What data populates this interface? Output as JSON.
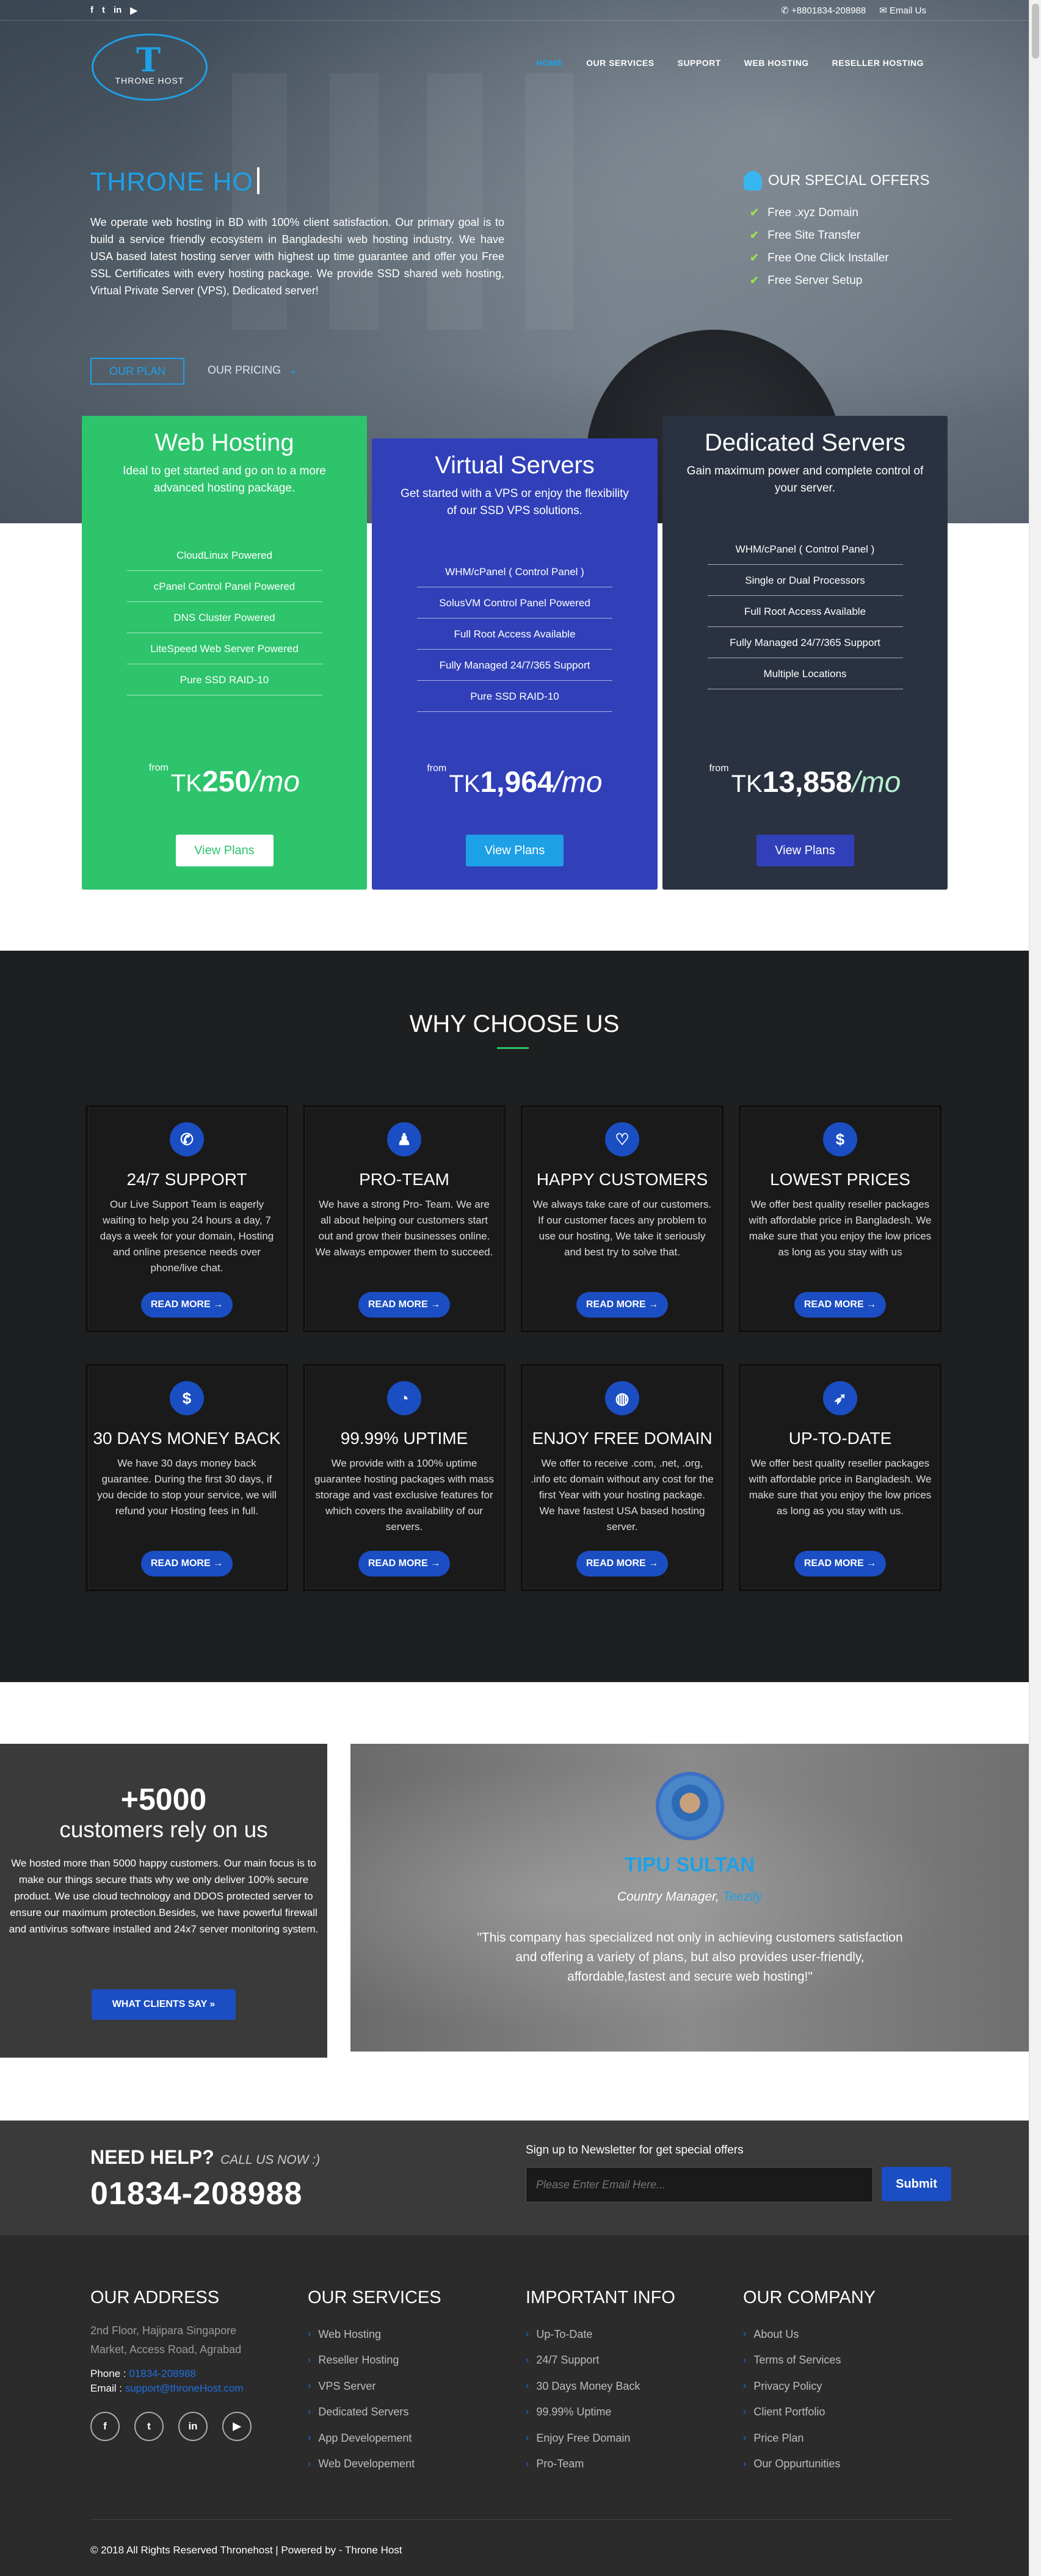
{
  "topbar": {
    "social": [
      "f",
      "t",
      "in",
      "▶"
    ],
    "phone": "+8801834-208988",
    "email": "Email Us"
  },
  "logo": {
    "text": "THRONE HOST"
  },
  "nav": [
    "HOME",
    "OUR SERVICES",
    "SUPPORT",
    "WEB HOSTING",
    "RESELLER HOSTING"
  ],
  "hero": {
    "title": "THRONE HO",
    "description": "We operate web hosting in BD with 100% client satisfaction. Our primary goal is to build a service friendly ecosystem in Bangladeshi web hosting industry. We have USA based latest hosting server with highest up time guarantee and offer you Free SSL Certificates with every hosting package. We provide SSD shared web hosting, Virtual Private Server (VPS), Dedicated server!",
    "plan_button": "OUR PLAN",
    "pricing_button": "OUR PRICING"
  },
  "offers": {
    "title": "OUR SPECIAL OFFERS",
    "items": [
      "Free .xyz Domain",
      "Free Site Transfer",
      "Free One Click Installer",
      "Free Server Setup"
    ]
  },
  "pricing": [
    {
      "title": "Web Hosting",
      "subtitle": "Ideal to get started and go on to a more advanced hosting package.",
      "features": [
        "CloudLinux Powered",
        "cPanel Control Panel Powered",
        "DNS Cluster Powered",
        "LiteSpeed Web Server Powered",
        "Pure SSD RAID-10"
      ],
      "from": "from",
      "currency": "TK",
      "amount": "250",
      "period": "/mo",
      "button": "View Plans",
      "color": "#2dc46c"
    },
    {
      "title": "Virtual Servers",
      "subtitle": "Get started with a VPS or enjoy the flexibility of our SSD VPS solutions.",
      "features": [
        "WHM/cPanel ( Control Panel )",
        "SolusVM Control Panel Powered",
        "Full Root Access Available",
        "Fully Managed 24/7/365 Support",
        "Pure SSD RAID-10"
      ],
      "from": "from",
      "currency": "TK",
      "amount": "1,964",
      "period": "/mo",
      "button": "View Plans",
      "color": "#3140b8"
    },
    {
      "title": "Dedicated Servers",
      "subtitle": "Gain maximum power and complete control of your server.",
      "features": [
        "WHM/cPanel ( Control Panel )",
        "Single or Dual Processors",
        "Full Root Access Available",
        "Fully Managed 24/7/365 Support",
        "Multiple Locations"
      ],
      "from": "from",
      "currency": "TK",
      "amount": "13,858",
      "period": "/mo",
      "button": "View Plans",
      "color": "#2a3140"
    }
  ],
  "why": {
    "title": "WHY CHOOSE US",
    "read_more": "READ MORE →",
    "features": [
      {
        "icon": "phone-icon",
        "glyph": "✆",
        "title": "24/7 SUPPORT",
        "text": "Our Live Support Team is eagerly waiting to help you 24 hours a day, 7 days a week for your domain, Hosting and online presence needs over phone/live chat."
      },
      {
        "icon": "team-icon",
        "glyph": "♟",
        "title": "PRO-TEAM",
        "text": "We have a strong Pro- Team. We are all about helping our customers start out and grow their businesses online. We always empower them to succeed."
      },
      {
        "icon": "heart-icon",
        "glyph": "♡",
        "title": "HAPPY CUSTOMERS",
        "text": "We always take care of our customers. If our customer faces any problem to use our hosting, We take it seriously and best try to solve that."
      },
      {
        "icon": "money-icon",
        "glyph": "$",
        "title": "LOWEST PRICES",
        "text": "We offer best quality reseller packages with affordable price in Bangladesh. We make sure that you enjoy the low prices as long as you stay with us"
      },
      {
        "icon": "money-back-icon",
        "glyph": "$",
        "title": "30 DAYS MONEY BACK",
        "text": "We have 30 days money back guarantee. During the first 30 days, if you decide to stop your service, we will refund your Hosting fees in full."
      },
      {
        "icon": "gauge-icon",
        "glyph": "◔",
        "title": "99.99% UPTIME",
        "text": "We provide with a 100% uptime guarantee hosting packages with mass storage and vast exclusive features for which covers the availability of our servers."
      },
      {
        "icon": "globe-icon",
        "glyph": "◍",
        "title": "ENJOY FREE DOMAIN",
        "text": "We offer to receive .com, .net, .org, .info etc domain without any cost for the first Year with your hosting package. We have fastest USA based hosting server."
      },
      {
        "icon": "rocket-icon",
        "glyph": "➶",
        "title": "UP-TO-DATE",
        "text": "We offer best quality reseller packages with affordable price in Bangladesh. We make sure that you enjoy the low prices as long as you stay with us."
      }
    ]
  },
  "clients": {
    "count": "+5000",
    "subtitle": "customers rely on us",
    "text": "We hosted more than 5000 happy customers. Our main focus is to make our things secure thats why we only deliver 100% secure product. We use cloud technology and DDOS protected server to ensure our maximum protection.Besides, we have powerful firewall and antivirus software installed and 24x7 server monitoring system.",
    "button": "WHAT CLIENTS SAY »",
    "testimonial": {
      "name": "TIPU SULTAN",
      "role": "Country Manager,",
      "company": "Teezily",
      "quote": "\"This company has specialized not only in achieving customers satisfaction and offering a variety of plans, but also provides user-friendly, affordable,fastest and secure web hosting!\""
    }
  },
  "help": {
    "title": "NEED HELP?",
    "call": "CALL US NOW :)",
    "phone": "01834-208988",
    "newsletter_label": "Sign up to Newsletter for get special offers",
    "email_placeholder": "Please Enter Email Here...",
    "submit": "Submit"
  },
  "footer": {
    "address": {
      "title": "OUR ADDRESS",
      "lines": "2nd Floor, Hajipara Singapore Market, Access Road, Agrabad",
      "phone_label": "Phone :",
      "phone": "01834-208988",
      "email_label": "Email :",
      "email": "support@throneHost.com",
      "social": [
        "f",
        "t",
        "in",
        "▶"
      ]
    },
    "services": {
      "title": "OUR SERVICES",
      "items": [
        "Web Hosting",
        "Reseller Hosting",
        "VPS Server",
        "Dedicated Servers",
        "App Developement",
        "Web Developement"
      ]
    },
    "info": {
      "title": "IMPORTANT INFO",
      "items": [
        "Up-To-Date",
        "24/7 Support",
        "30 Days Money Back",
        "99.99% Uptime",
        "Enjoy Free Domain",
        "Pro-Team"
      ]
    },
    "company": {
      "title": "OUR COMPANY",
      "items": [
        "About Us",
        "Terms of Services",
        "Privacy Policy",
        "Client Portfolio",
        "Price Plan",
        "Our Oppurtunities"
      ]
    },
    "copyright": "© 2018 All Rights Reserved Thronehost | Powered by - Throne Host"
  }
}
